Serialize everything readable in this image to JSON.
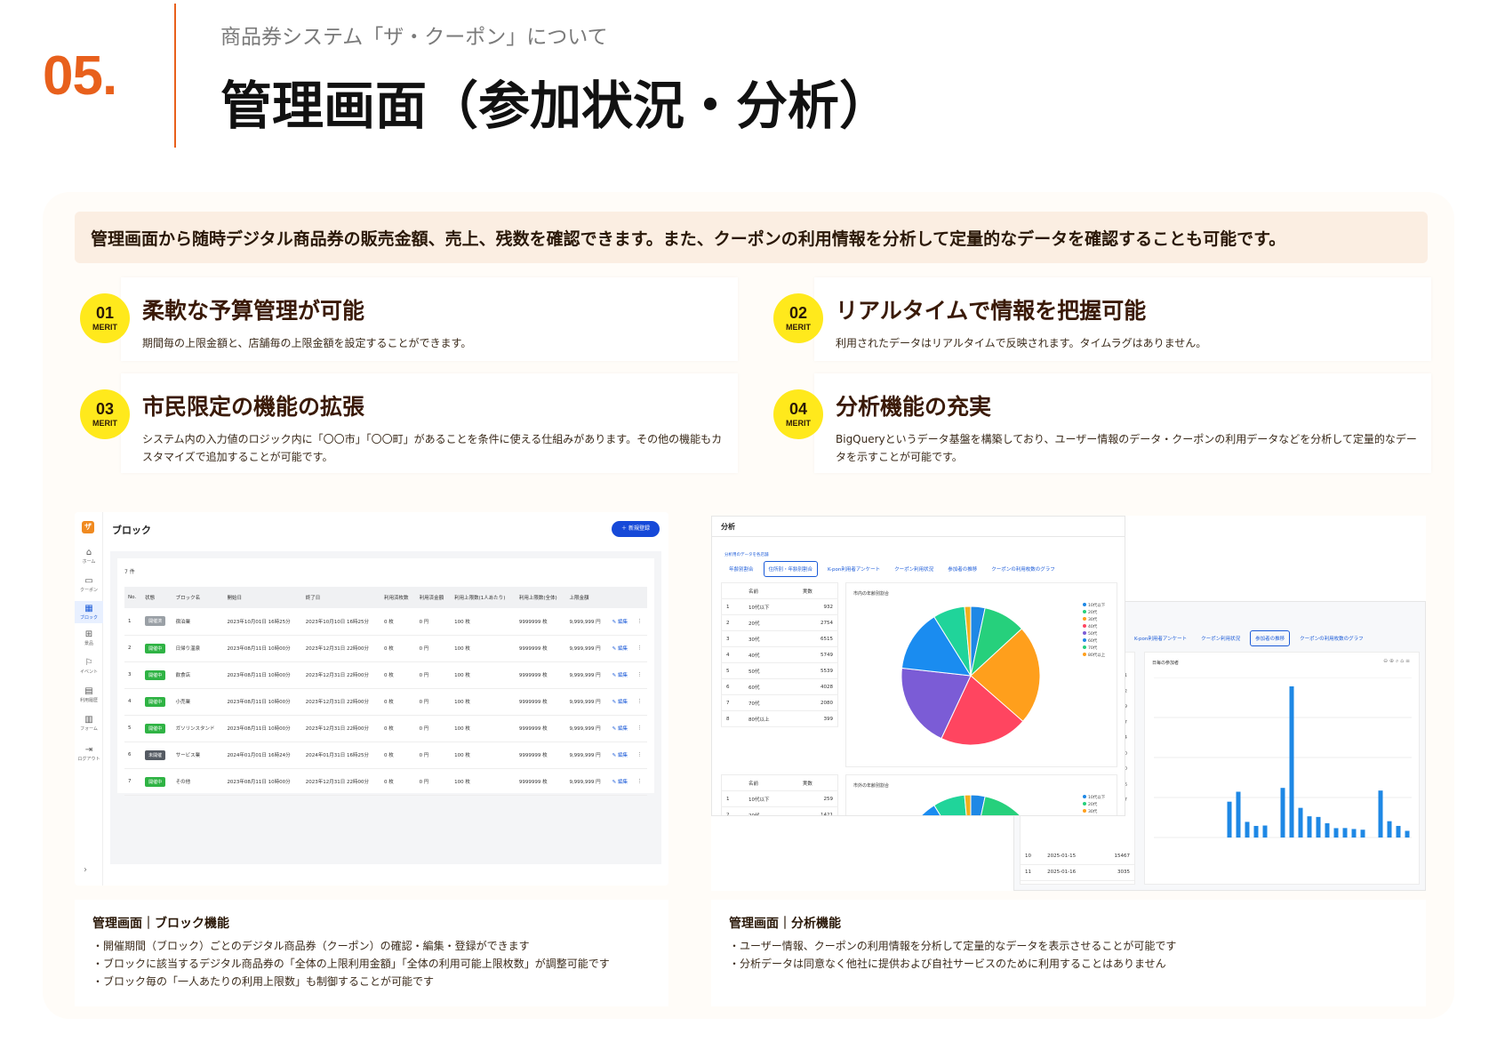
{
  "header": {
    "number": "05.",
    "subtitle": "商品券システム「ザ・クーポン」について",
    "title": "管理画面（参加状況・分析）"
  },
  "intro": "管理画面から随時デジタル商品券の販売金額、売上、残数を確認できます。また、クーポンの利用情報を分析して定量的なデータを確認することも可能です。",
  "merits": [
    {
      "num": "01",
      "tag": "MERIT",
      "title": "柔軟な予算管理が可能",
      "desc": "期間毎の上限金額と、店舗毎の上限金額を設定することができます。"
    },
    {
      "num": "02",
      "tag": "MERIT",
      "title": "リアルタイムで情報を把握可能",
      "desc": "利用されたデータはリアルタイムで反映されます。タイムラグはありません。"
    },
    {
      "num": "03",
      "tag": "MERIT",
      "title": "市民限定の機能の拡張",
      "desc": "システム内の入力値のロジック内に「〇〇市」「〇〇町」があることを条件に使える仕組みがあります。その他の機能もカスタマイズで追加することが可能です。"
    },
    {
      "num": "04",
      "tag": "MERIT",
      "title": "分析機能の充実",
      "desc": "BigQueryというデータ基盤を構築しており、ユーザー情報のデータ・クーポンの利用データなどを分析して定量的なデータを示すことが可能です。"
    }
  ],
  "block_screen": {
    "logo": "ザ",
    "title": "ブロック",
    "new_button": "＋ 新規登録",
    "count": "7 件",
    "nav": [
      {
        "icon": "⌂",
        "label": "ホーム"
      },
      {
        "icon": "▭",
        "label": "クーポン"
      },
      {
        "icon": "▦",
        "label": "ブロック"
      },
      {
        "icon": "⊞",
        "label": "景品"
      },
      {
        "icon": "⚐",
        "label": "イベント"
      },
      {
        "icon": "▤",
        "label": "利用履歴"
      },
      {
        "icon": "▥",
        "label": "フォーム"
      },
      {
        "icon": "⇥",
        "label": "ログアウト"
      }
    ],
    "chevron": "›",
    "columns": [
      "No.",
      "状態",
      "ブロック名",
      "開始日",
      "終了日",
      "利用済枚数",
      "利用済金額",
      "利用上限数(1人あたり)",
      "利用上限数(全体)",
      "上限金額",
      "",
      ""
    ],
    "rows": [
      {
        "no": "1",
        "status": "開催済",
        "status_color": "#9aa0a6",
        "name": "宿泊業",
        "start": "2023年10月01日 16時25分",
        "end": "2023年10月10日 16時25分",
        "used": "0 枚",
        "used_amt": "0 円",
        "limit_user": "100 枚",
        "limit_all": "9999999 枚",
        "limit_amt": "9,999,999 円",
        "edit": "✎ 編集",
        "more": "⋮"
      },
      {
        "no": "2",
        "status": "開催中",
        "status_color": "#2fb344",
        "name": "日帰り温泉",
        "start": "2023年08月11日 10時00分",
        "end": "2023年12月31日 22時00分",
        "used": "0 枚",
        "used_amt": "0 円",
        "limit_user": "100 枚",
        "limit_all": "9999999 枚",
        "limit_amt": "9,999,999 円",
        "edit": "✎ 編集",
        "more": "⋮"
      },
      {
        "no": "3",
        "status": "開催中",
        "status_color": "#2fb344",
        "name": "飲食店",
        "start": "2023年08月11日 10時00分",
        "end": "2023年12月31日 22時00分",
        "used": "0 枚",
        "used_amt": "0 円",
        "limit_user": "100 枚",
        "limit_all": "9999999 枚",
        "limit_amt": "9,999,999 円",
        "edit": "✎ 編集",
        "more": "⋮"
      },
      {
        "no": "4",
        "status": "開催中",
        "status_color": "#2fb344",
        "name": "小売業",
        "start": "2023年08月11日 10時00分",
        "end": "2023年12月31日 22時00分",
        "used": "0 枚",
        "used_amt": "0 円",
        "limit_user": "100 枚",
        "limit_all": "9999999 枚",
        "limit_amt": "9,999,999 円",
        "edit": "✎ 編集",
        "more": "⋮"
      },
      {
        "no": "5",
        "status": "開催中",
        "status_color": "#2fb344",
        "name": "ガソリンスタンド",
        "start": "2023年08月11日 10時00分",
        "end": "2023年12月31日 22時00分",
        "used": "0 枚",
        "used_amt": "0 円",
        "limit_user": "100 枚",
        "limit_all": "9999999 枚",
        "limit_amt": "9,999,999 円",
        "edit": "✎ 編集",
        "more": "⋮"
      },
      {
        "no": "6",
        "status": "未開催",
        "status_color": "#555b63",
        "name": "サービス業",
        "start": "2024年01月01日 16時24分",
        "end": "2024年01月31日 16時25分",
        "used": "0 枚",
        "used_amt": "0 円",
        "limit_user": "100 枚",
        "limit_all": "9999999 枚",
        "limit_amt": "9,999,999 円",
        "edit": "✎ 編集",
        "more": "⋮"
      },
      {
        "no": "7",
        "status": "開催中",
        "status_color": "#2fb344",
        "name": "その他",
        "start": "2023年08月11日 10時00分",
        "end": "2023年12月31日 22時00分",
        "used": "0 枚",
        "used_amt": "0 円",
        "limit_user": "100 枚",
        "limit_all": "9999999 枚",
        "limit_amt": "9,999,999 円",
        "edit": "✎ 編集",
        "more": "⋮"
      }
    ]
  },
  "analysis_screen": {
    "title": "分析",
    "small_label": "分析用のデータを各店舗",
    "tabs": [
      "年齢別割合",
      "住所別・年齢別割合",
      "K-pon利用者アンケート",
      "クーポン利用状況",
      "参加者の推移",
      "クーポンの利用枚数のグラフ"
    ],
    "active_tab": 1,
    "table_head": [
      "名前",
      "実数"
    ],
    "age_rows": [
      {
        "i": "1",
        "name": "10代以下",
        "v": "932"
      },
      {
        "i": "2",
        "name": "20代",
        "v": "2754"
      },
      {
        "i": "3",
        "name": "30代",
        "v": "6515"
      },
      {
        "i": "4",
        "name": "40代",
        "v": "5749"
      },
      {
        "i": "5",
        "name": "50代",
        "v": "5539"
      },
      {
        "i": "6",
        "name": "60代",
        "v": "4028"
      },
      {
        "i": "7",
        "name": "70代",
        "v": "2080"
      },
      {
        "i": "8",
        "name": "80代以上",
        "v": "399"
      }
    ],
    "age_rows_2": [
      {
        "i": "1",
        "name": "10代以下",
        "v": "259"
      },
      {
        "i": "2",
        "name": "20代",
        "v": "1421"
      }
    ],
    "pie_title": "市内の年齢別割合",
    "pie_title_2": "市外の年齢別割合",
    "legend": [
      "10代以下",
      "20代",
      "30代",
      "40代",
      "50代",
      "60代",
      "70代",
      "80代以上"
    ],
    "legend_colors": [
      "#1e88e5",
      "#26d07c",
      "#ff9f1c",
      "#ff4560",
      "#7b5cd6",
      "#1e88e5",
      "#26d07c",
      "#ff9f1c"
    ],
    "tabs_b": [
      "K-pon利用者アンケート",
      "クーポン利用状況",
      "参加者の推移",
      "クーポンの利用枚数のグラフ"
    ],
    "active_tab_b": 2,
    "bar_title": "日毎の参加者",
    "rows_b": [
      {
        "i": "10",
        "date": "2025-01-15",
        "v": "15467"
      },
      {
        "i": "11",
        "date": "2025-01-16",
        "v": "3035"
      }
    ],
    "left_values_b": [
      "1",
      "2",
      "9",
      "607",
      "004",
      "850",
      "140",
      "226",
      "077"
    ]
  },
  "chart_data": [
    {
      "type": "pie",
      "title": "市内の年齢別割合",
      "categories": [
        "10代以下",
        "20代",
        "30代",
        "40代",
        "50代",
        "60代",
        "70代",
        "80代以上"
      ],
      "values": [
        932,
        2754,
        6515,
        5749,
        5539,
        4028,
        2080,
        399
      ],
      "slice_labels": [
        "",
        "",
        "",
        "",
        "",
        "",
        "",
        ""
      ],
      "colors": [
        "#1e88e5",
        "#26d07c",
        "#ff9f1c",
        "#ff4560",
        "#7b5cd6",
        "#1a8cf0",
        "#20d49a",
        "#f2b01e"
      ]
    },
    {
      "type": "bar",
      "title": "日毎の参加者",
      "values": [
        0,
        0,
        0,
        0,
        0,
        0,
        0,
        0,
        3667,
        4685,
        1600,
        1186,
        1226,
        0,
        5077,
        15467,
        3035,
        2171,
        2105,
        1461,
        960,
        970,
        870,
        797,
        0,
        4805,
        1669,
        1186,
        682
      ]
    }
  ],
  "captions": [
    {
      "title": "管理画面｜ブロック機能",
      "lines": [
        "・開催期間（ブロック）ごとのデジタル商品券（クーポン）の確認・編集・登録ができます",
        "・ブロックに該当するデジタル商品券の「全体の上限利用金額」「全体の利用可能上限枚数」が調整可能です",
        "・ブロック毎の「一人あたりの利用上限数」も制御することが可能です"
      ]
    },
    {
      "title": "管理画面｜分析機能",
      "lines": [
        "・ユーザー情報、クーポンの利用情報を分析して定量的なデータを表示させることが可能です",
        "・分析データは同意なく他社に提供および自社サービスのために利用することはありません"
      ]
    }
  ]
}
